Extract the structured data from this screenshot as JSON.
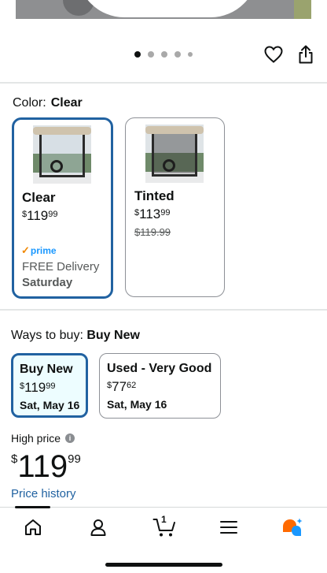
{
  "carousel": {
    "dots": [
      "image-1",
      "image-2",
      "image-3",
      "image-4",
      "image-5"
    ],
    "active_index": 0
  },
  "actions": {
    "favorite_icon": "heart-icon",
    "share_icon": "share-icon"
  },
  "color": {
    "label": "Color:",
    "selected": "Clear",
    "options": [
      {
        "name": "Clear",
        "price": {
          "currency": "$",
          "whole": "119",
          "fraction": "99"
        },
        "badge": "prime",
        "delivery": "FREE Delivery",
        "delivery_day": "Saturday",
        "selected": true
      },
      {
        "name": "Tinted",
        "price": {
          "currency": "$",
          "whole": "113",
          "fraction": "99"
        },
        "list_price": "$119.99",
        "selected": false
      }
    ]
  },
  "ways_to_buy": {
    "label": "Ways to buy:",
    "selected": "Buy New",
    "options": [
      {
        "title": "Buy New",
        "price": {
          "currency": "$",
          "whole": "119",
          "fraction": "99"
        },
        "date": "Sat, May 16",
        "selected": true
      },
      {
        "title": "Used - Very Good",
        "price": {
          "currency": "$",
          "whole": "77",
          "fraction": "62"
        },
        "date": "Sat, May 16",
        "selected": false
      }
    ]
  },
  "high_price": {
    "label": "High price",
    "info_icon": "i",
    "price": {
      "currency": "$",
      "whole": "119",
      "fraction": "99"
    },
    "history_link": "Price history"
  },
  "bottom_nav": {
    "items": [
      "home-icon",
      "account-icon",
      "cart-icon",
      "menu-icon",
      "rufus-icon"
    ],
    "cart_count": "1"
  },
  "colors": {
    "accent": "#2162a1",
    "prime_blue": "#1a98ff",
    "prime_check": "#f08804",
    "rufus_orange": "#ff6a00",
    "rufus_blue": "#1a98ff"
  }
}
